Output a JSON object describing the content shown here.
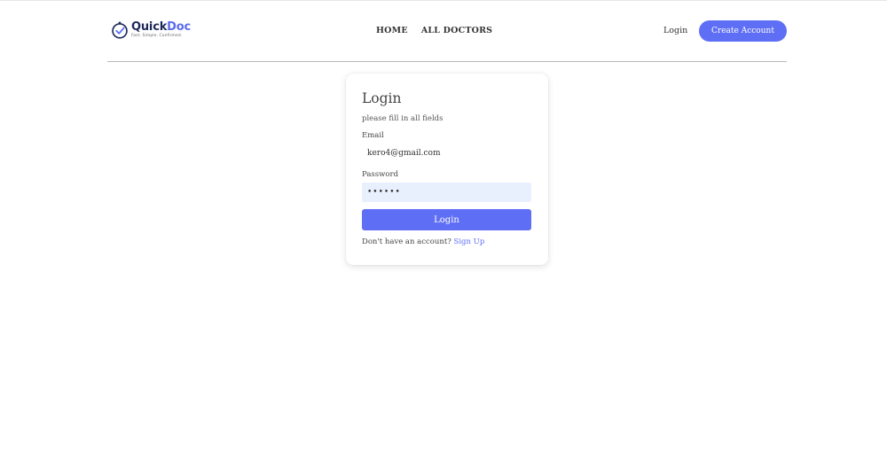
{
  "brand": {
    "name_part1": "Quick",
    "name_part2": "Doc",
    "tagline": "Fast. Simple. Confirmed.",
    "primary_color": "#5f6ff5",
    "dark_color": "#1f2a5a"
  },
  "nav": {
    "links": [
      {
        "label": "HOME"
      },
      {
        "label": "ALL DOCTORS"
      }
    ],
    "login_label": "Login",
    "create_account_label": "Create Account"
  },
  "login_form": {
    "title": "Login",
    "subtitle": "please fill in all fields",
    "email_label": "Email",
    "email_value": "kero4@gmail.com",
    "password_label": "Password",
    "password_value": "123456",
    "submit_label": "Login",
    "no_account_text": "Don't have an account?",
    "signup_label": "Sign Up"
  },
  "icons": {
    "logo": "clock-check-icon"
  }
}
